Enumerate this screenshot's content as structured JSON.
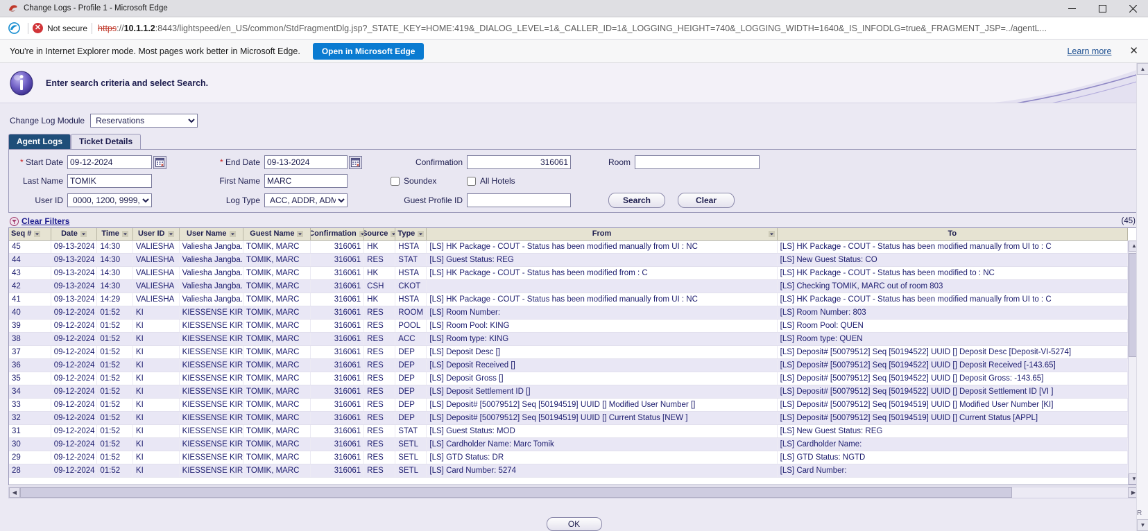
{
  "window": {
    "title": "Change Logs - Profile 1 - Microsoft Edge",
    "minimize_label": "Minimize",
    "maximize_label": "Maximize",
    "close_label": "Close"
  },
  "address_bar": {
    "security_label": "Not secure",
    "security_icon": "not-secure-shield-icon",
    "url_scheme": "https",
    "url_separator": "://",
    "url_host": "10.1.1.2",
    "url_rest": ":8443/lightspeed/en_US/common/StdFragmentDlg.jsp?_STATE_KEY=HOME:419&_DIALOG_LEVEL=1&_CALLER_ID=1&_LOGGING_HEIGHT=740&_LOGGING_WIDTH=1640&_IS_INFODLG=true&_FRAGMENT_JSP=../agentL..."
  },
  "ie_banner": {
    "message": "You're in Internet Explorer mode. Most pages work better in Microsoft Edge.",
    "open_button": "Open in Microsoft Edge",
    "learn_more": "Learn more",
    "close_icon": "close-icon"
  },
  "app_header": {
    "message": "Enter search criteria and select Search.",
    "info_icon": "info-icon"
  },
  "module": {
    "label": "Change Log Module",
    "selected": "Reservations",
    "options": [
      "Reservations"
    ]
  },
  "tabs": [
    {
      "label": "Agent Logs",
      "active": true
    },
    {
      "label": "Ticket Details",
      "active": false
    }
  ],
  "criteria": {
    "start_date": {
      "label": "Start Date",
      "required": true,
      "value": "09-12-2024",
      "calendar_icon": "calendar-icon"
    },
    "end_date": {
      "label": "End Date",
      "required": true,
      "value": "09-13-2024",
      "calendar_icon": "calendar-icon"
    },
    "confirmation": {
      "label": "Confirmation",
      "value": "316061"
    },
    "room": {
      "label": "Room",
      "value": ""
    },
    "last_name": {
      "label": "Last Name",
      "value": "TOMIK"
    },
    "first_name": {
      "label": "First Name",
      "value": "MARC"
    },
    "soundex": {
      "label": "Soundex",
      "checked": false
    },
    "all_hotels": {
      "label": "All Hotels",
      "checked": false
    },
    "user_id": {
      "label": "User ID",
      "selected": "0000, 1200, 9999, ..."
    },
    "log_type": {
      "label": "Log Type",
      "selected": "ACC, ADDR, ADM,..."
    },
    "guest_profile_id": {
      "label": "Guest Profile ID",
      "value": ""
    },
    "search_button": "Search",
    "clear_button": "Clear"
  },
  "filters": {
    "clear_filters_label": "Clear Filters",
    "clear_filters_icon": "clear-filter-icon",
    "record_count": "(45)"
  },
  "grid": {
    "columns": [
      {
        "key": "seq",
        "label": "Seq #",
        "filter": true
      },
      {
        "key": "date",
        "label": "Date",
        "filter": true
      },
      {
        "key": "time",
        "label": "Time",
        "filter": true
      },
      {
        "key": "user_id",
        "label": "User ID",
        "filter": true
      },
      {
        "key": "user_name",
        "label": "User Name",
        "filter": true
      },
      {
        "key": "guest_name",
        "label": "Guest Name",
        "filter": true
      },
      {
        "key": "confirmation",
        "label": "Confirmation",
        "filter": true
      },
      {
        "key": "source",
        "label": "Source",
        "filter": true
      },
      {
        "key": "type",
        "label": "Type",
        "filter": true
      },
      {
        "key": "from",
        "label": "From",
        "filter": true
      },
      {
        "key": "to",
        "label": "To",
        "filter": false
      }
    ],
    "rows": [
      {
        "seq": "45",
        "date": "09-13-2024",
        "time": "14:30",
        "user_id": "VALIESHA",
        "user_name": "Valiesha Jangba...",
        "guest_name": "TOMIK, MARC",
        "confirmation": "316061",
        "source": "HK",
        "type": "HSTA",
        "from": "[LS] HK Package - COUT - Status has been modified manually from UI : NC",
        "to": "[LS] HK Package - COUT - Status has been modified manually from UI to : C"
      },
      {
        "seq": "44",
        "date": "09-13-2024",
        "time": "14:30",
        "user_id": "VALIESHA",
        "user_name": "Valiesha Jangba...",
        "guest_name": "TOMIK, MARC",
        "confirmation": "316061",
        "source": "RES",
        "type": "STAT",
        "from": "[LS] Guest Status: REG",
        "to": "[LS] New Guest Status: CO"
      },
      {
        "seq": "43",
        "date": "09-13-2024",
        "time": "14:30",
        "user_id": "VALIESHA",
        "user_name": "Valiesha Jangba...",
        "guest_name": "TOMIK, MARC",
        "confirmation": "316061",
        "source": "HK",
        "type": "HSTA",
        "from": "[LS] HK Package - COUT - Status has been modified from : C",
        "to": "[LS] HK Package - COUT - Status has been modified to : NC"
      },
      {
        "seq": "42",
        "date": "09-13-2024",
        "time": "14:30",
        "user_id": "VALIESHA",
        "user_name": "Valiesha Jangba...",
        "guest_name": "TOMIK, MARC",
        "confirmation": "316061",
        "source": "CSH",
        "type": "CKOT",
        "from": "",
        "to": "[LS] Checking TOMIK, MARC out of room 803"
      },
      {
        "seq": "41",
        "date": "09-13-2024",
        "time": "14:29",
        "user_id": "VALIESHA",
        "user_name": "Valiesha Jangba...",
        "guest_name": "TOMIK, MARC",
        "confirmation": "316061",
        "source": "HK",
        "type": "HSTA",
        "from": "[LS] HK Package - COUT - Status has been modified manually from UI : NC",
        "to": "[LS] HK Package - COUT - Status has been modified manually from UI to : C"
      },
      {
        "seq": "40",
        "date": "09-12-2024",
        "time": "01:52",
        "user_id": "KI",
        "user_name": "KIESSENSE KIR...",
        "guest_name": "TOMIK, MARC",
        "confirmation": "316061",
        "source": "RES",
        "type": "ROOM",
        "from": "[LS] Room Number:",
        "to": "[LS] Room Number: 803"
      },
      {
        "seq": "39",
        "date": "09-12-2024",
        "time": "01:52",
        "user_id": "KI",
        "user_name": "KIESSENSE KIR...",
        "guest_name": "TOMIK, MARC",
        "confirmation": "316061",
        "source": "RES",
        "type": "POOL",
        "from": "[LS] Room Pool: KING",
        "to": "[LS] Room Pool: QUEN"
      },
      {
        "seq": "38",
        "date": "09-12-2024",
        "time": "01:52",
        "user_id": "KI",
        "user_name": "KIESSENSE KIR...",
        "guest_name": "TOMIK, MARC",
        "confirmation": "316061",
        "source": "RES",
        "type": "ACC",
        "from": "[LS] Room type: KING",
        "to": "[LS] Room type: QUEN"
      },
      {
        "seq": "37",
        "date": "09-12-2024",
        "time": "01:52",
        "user_id": "KI",
        "user_name": "KIESSENSE KIR...",
        "guest_name": "TOMIK, MARC",
        "confirmation": "316061",
        "source": "RES",
        "type": "DEP",
        "from": "[LS] Deposit Desc []",
        "to": "[LS] Deposit# [50079512] Seq [50194522] UUID [] Deposit Desc [Deposit-VI-5274]"
      },
      {
        "seq": "36",
        "date": "09-12-2024",
        "time": "01:52",
        "user_id": "KI",
        "user_name": "KIESSENSE KIR...",
        "guest_name": "TOMIK, MARC",
        "confirmation": "316061",
        "source": "RES",
        "type": "DEP",
        "from": "[LS] Deposit Received []",
        "to": "[LS] Deposit# [50079512] Seq [50194522] UUID [] Deposit Received [-143.65]"
      },
      {
        "seq": "35",
        "date": "09-12-2024",
        "time": "01:52",
        "user_id": "KI",
        "user_name": "KIESSENSE KIR...",
        "guest_name": "TOMIK, MARC",
        "confirmation": "316061",
        "source": "RES",
        "type": "DEP",
        "from": "[LS] Deposit Gross []",
        "to": "[LS] Deposit# [50079512] Seq [50194522] UUID [] Deposit Gross: -143.65]"
      },
      {
        "seq": "34",
        "date": "09-12-2024",
        "time": "01:52",
        "user_id": "KI",
        "user_name": "KIESSENSE KIR...",
        "guest_name": "TOMIK, MARC",
        "confirmation": "316061",
        "source": "RES",
        "type": "DEP",
        "from": "[LS] Deposit Settlement ID []",
        "to": "[LS] Deposit# [50079512] Seq [50194522] UUID [] Deposit Settlement ID [VI ]"
      },
      {
        "seq": "33",
        "date": "09-12-2024",
        "time": "01:52",
        "user_id": "KI",
        "user_name": "KIESSENSE KIR...",
        "guest_name": "TOMIK, MARC",
        "confirmation": "316061",
        "source": "RES",
        "type": "DEP",
        "from": "[LS] Deposit# [50079512] Seq [50194519] UUID [] Modified User Number []",
        "to": "[LS] Deposit# [50079512] Seq [50194519] UUID [] Modified User Number [KI]"
      },
      {
        "seq": "32",
        "date": "09-12-2024",
        "time": "01:52",
        "user_id": "KI",
        "user_name": "KIESSENSE KIR...",
        "guest_name": "TOMIK, MARC",
        "confirmation": "316061",
        "source": "RES",
        "type": "DEP",
        "from": "[LS] Deposit# [50079512] Seq [50194519] UUID [] Current Status [NEW ]",
        "to": "[LS] Deposit# [50079512] Seq [50194519] UUID [] Current Status [APPL]"
      },
      {
        "seq": "31",
        "date": "09-12-2024",
        "time": "01:52",
        "user_id": "KI",
        "user_name": "KIESSENSE KIR...",
        "guest_name": "TOMIK, MARC",
        "confirmation": "316061",
        "source": "RES",
        "type": "STAT",
        "from": "[LS] Guest Status: MOD",
        "to": "[LS] New Guest Status: REG"
      },
      {
        "seq": "30",
        "date": "09-12-2024",
        "time": "01:52",
        "user_id": "KI",
        "user_name": "KIESSENSE KIR...",
        "guest_name": "TOMIK, MARC",
        "confirmation": "316061",
        "source": "RES",
        "type": "SETL",
        "from": "[LS] Cardholder Name: Marc Tomik",
        "to": "[LS] Cardholder Name:"
      },
      {
        "seq": "29",
        "date": "09-12-2024",
        "time": "01:52",
        "user_id": "KI",
        "user_name": "KIESSENSE KIR...",
        "guest_name": "TOMIK, MARC",
        "confirmation": "316061",
        "source": "RES",
        "type": "SETL",
        "from": "[LS] GTD Status: DR",
        "to": "[LS] GTD Status: NGTD"
      },
      {
        "seq": "28",
        "date": "09-12-2024",
        "time": "01:52",
        "user_id": "KI",
        "user_name": "KIESSENSE KIR...",
        "guest_name": "TOMIK, MARC",
        "confirmation": "316061",
        "source": "RES",
        "type": "SETL",
        "from": "[LS] Card Number: 5274",
        "to": "[LS] Card Number:"
      }
    ]
  },
  "footer": {
    "ok_button": "OK"
  },
  "page_scroll": {
    "resize_label": "R"
  },
  "colors": {
    "accent_blue": "#0a7bd1",
    "tab_active": "#1f4e79",
    "grid_header": "#e6e3d2",
    "row_alt": "#e9e7f5",
    "app_bg": "#ebe9f3",
    "text_navy": "#1c1c6e",
    "required_red": "#cc2222",
    "not_secure_red": "#d13438"
  }
}
